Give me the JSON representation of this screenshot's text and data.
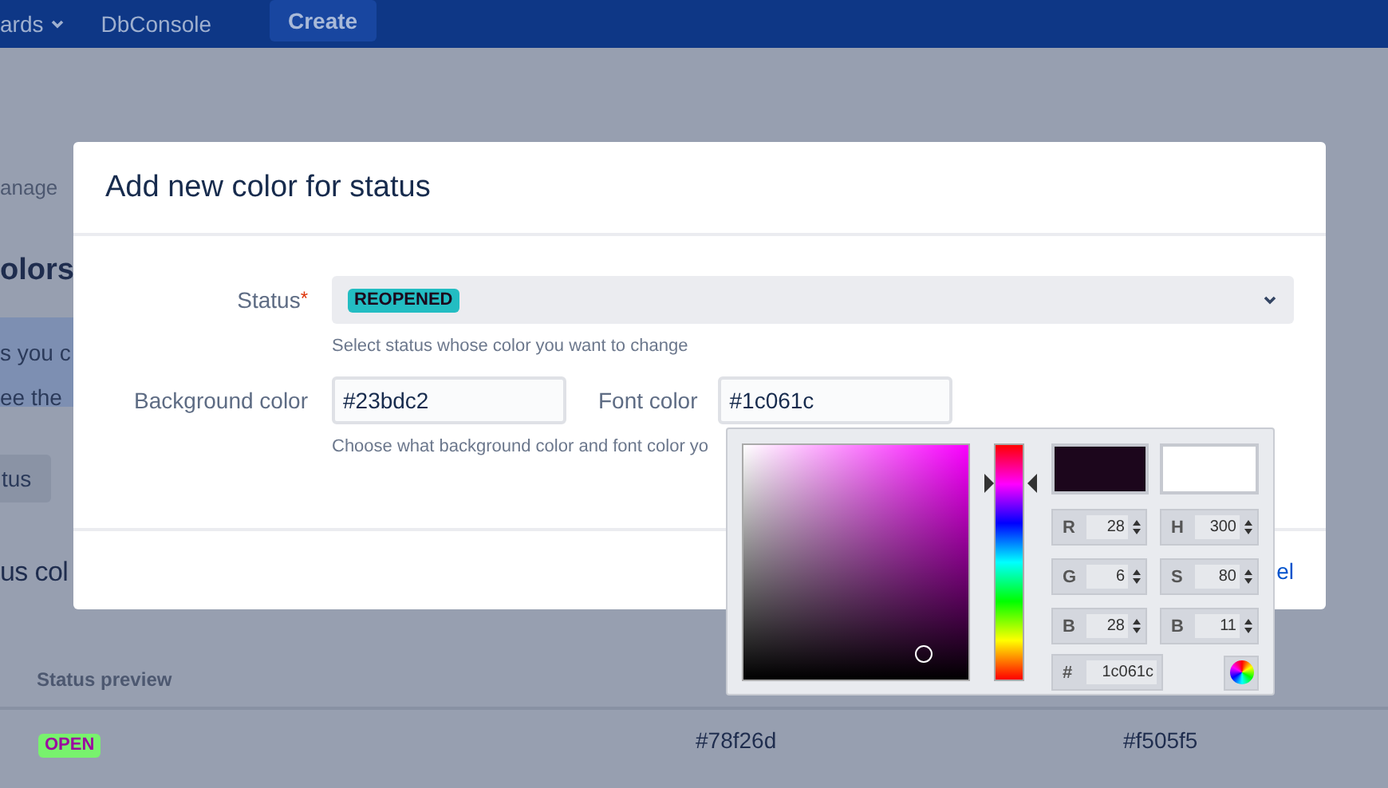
{
  "nav": {
    "items": [
      {
        "label": "ards",
        "kind": "dropdown"
      },
      {
        "label": "DbConsole",
        "kind": "link"
      }
    ],
    "create": "Create"
  },
  "page": {
    "breadcrumb": "anage",
    "heading": "olors",
    "info_lines": [
      "s you c",
      "ee the"
    ],
    "button": "tus",
    "section_heading": "us col",
    "table": {
      "columns": [
        "Status preview"
      ],
      "rows": [
        {
          "status": "OPEN",
          "color": "#78f26d",
          "cells": [
            "#78f26d",
            "#f505f5"
          ]
        }
      ]
    }
  },
  "modal": {
    "title": "Add new color for status",
    "status": {
      "label": "Status",
      "required_mark": "*",
      "value": "REOPENED",
      "color": "#23bdc2",
      "help": "Select status whose color you want to change"
    },
    "background_color": {
      "label": "Background color",
      "value": "#23bdc2"
    },
    "font_color": {
      "label": "Font color",
      "value": "#1c061c"
    },
    "colors_help": "Choose what background color and font color yo",
    "footer_link": "el",
    "picker": {
      "hue": {
        "level": 0.83
      },
      "swatches": [
        {
          "color": "#1c061c"
        },
        {
          "color": "#ffffff"
        }
      ],
      "fields": [
        {
          "label": "R",
          "value": "28"
        },
        {
          "label": "H",
          "value": "300"
        },
        {
          "label": "G",
          "value": "6"
        },
        {
          "label": "S",
          "value": "80"
        },
        {
          "label": "B",
          "value": "28"
        },
        {
          "label": "B",
          "value": "11"
        }
      ],
      "hex": {
        "label": "#",
        "value": "1c061c"
      }
    }
  }
}
